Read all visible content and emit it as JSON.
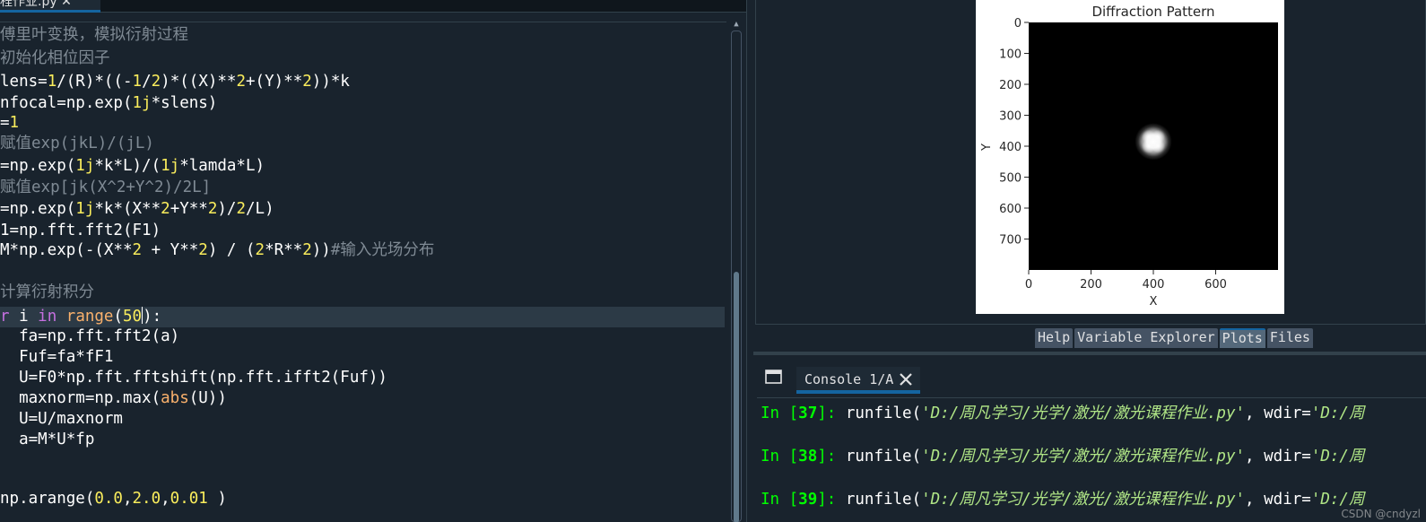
{
  "editor": {
    "tab_label": "程作业.py ✕",
    "lines": [
      [
        {
          "t": "傅里叶变换，模拟衍射过程",
          "c": "cm"
        }
      ],
      [
        {
          "t": "初始化相位因子",
          "c": "cm"
        }
      ],
      [
        {
          "t": "lens=",
          "c": ""
        },
        {
          "t": "1",
          "c": "num"
        },
        {
          "t": "/(R)*((-",
          "c": ""
        },
        {
          "t": "1",
          "c": "num"
        },
        {
          "t": "/",
          "c": ""
        },
        {
          "t": "2",
          "c": "num"
        },
        {
          "t": ")*((X)**",
          "c": ""
        },
        {
          "t": "2",
          "c": "num"
        },
        {
          "t": "+(Y)**",
          "c": ""
        },
        {
          "t": "2",
          "c": "num"
        },
        {
          "t": "))*k",
          "c": ""
        }
      ],
      [
        {
          "t": "nfocal=np.exp(",
          "c": ""
        },
        {
          "t": "1j",
          "c": "num"
        },
        {
          "t": "*slens)",
          "c": ""
        }
      ],
      [
        {
          "t": "=",
          "c": ""
        },
        {
          "t": "1",
          "c": "num"
        }
      ],
      [
        {
          "t": "赋值exp(jkL)/(jL)",
          "c": "cm"
        }
      ],
      [
        {
          "t": "=np.exp(",
          "c": ""
        },
        {
          "t": "1j",
          "c": "num"
        },
        {
          "t": "*k*L)/(",
          "c": ""
        },
        {
          "t": "1j",
          "c": "num"
        },
        {
          "t": "*lamda*L)",
          "c": ""
        }
      ],
      [
        {
          "t": "赋值exp[jk(X^2+Y^2)/2L]",
          "c": "cm"
        }
      ],
      [
        {
          "t": "=np.exp(",
          "c": ""
        },
        {
          "t": "1j",
          "c": "num"
        },
        {
          "t": "*k*(X**",
          "c": ""
        },
        {
          "t": "2",
          "c": "num"
        },
        {
          "t": "+Y**",
          "c": ""
        },
        {
          "t": "2",
          "c": "num"
        },
        {
          "t": ")/",
          "c": ""
        },
        {
          "t": "2",
          "c": "num"
        },
        {
          "t": "/L)",
          "c": ""
        }
      ],
      [
        {
          "t": "1=np.fft.fft2(F1)",
          "c": ""
        }
      ],
      [
        {
          "t": "M*np.exp(-(X**",
          "c": ""
        },
        {
          "t": "2",
          "c": "num"
        },
        {
          "t": " + Y**",
          "c": ""
        },
        {
          "t": "2",
          "c": "num"
        },
        {
          "t": ") / (",
          "c": ""
        },
        {
          "t": "2",
          "c": "num"
        },
        {
          "t": "*R**",
          "c": ""
        },
        {
          "t": "2",
          "c": "num"
        },
        {
          "t": "))",
          "c": ""
        },
        {
          "t": "#输入光场分布",
          "c": "cm"
        }
      ],
      [],
      [
        {
          "t": "计算衍射积分",
          "c": "cm"
        }
      ],
      [
        {
          "t": "r",
          "c": "kw"
        },
        {
          "t": " i ",
          "c": ""
        },
        {
          "t": "in",
          "c": "kw"
        },
        {
          "t": " ",
          "c": ""
        },
        {
          "t": "range",
          "c": "bi"
        },
        {
          "t": "(",
          "c": ""
        },
        {
          "t": "50",
          "c": "num"
        },
        {
          "t": "|",
          "c": "cursor"
        },
        {
          "t": "):",
          "c": ""
        }
      ],
      [
        {
          "t": "  fa=np.fft.fft2(a)",
          "c": ""
        }
      ],
      [
        {
          "t": "  Fuf=fa*fF1",
          "c": ""
        }
      ],
      [
        {
          "t": "  U=F0*np.fft.fftshift(np.fft.ifft2(Fuf))",
          "c": ""
        }
      ],
      [
        {
          "t": "  maxnorm=np.max(",
          "c": ""
        },
        {
          "t": "abs",
          "c": "bi"
        },
        {
          "t": "(U))",
          "c": ""
        }
      ],
      [
        {
          "t": "  U=U/maxnorm",
          "c": ""
        }
      ],
      [
        {
          "t": "  a=M*U*fp",
          "c": ""
        }
      ],
      [],
      [],
      [
        {
          "t": "np.arange(",
          "c": ""
        },
        {
          "t": "0.0",
          "c": "num"
        },
        {
          "t": ",",
          "c": ""
        },
        {
          "t": "2.0",
          "c": "num"
        },
        {
          "t": ",",
          "c": ""
        },
        {
          "t": "0.01",
          "c": "num"
        },
        {
          "t": " )",
          "c": ""
        }
      ]
    ],
    "current_line": 13,
    "line_tops": [
      38,
      64,
      90,
      114,
      136,
      159,
      184,
      208,
      232,
      256,
      278,
      302,
      325,
      352,
      374,
      397,
      420,
      443,
      466,
      489,
      512,
      535,
      555
    ]
  },
  "plot": {
    "title": "Diffraction Pattern",
    "xlabel": "X",
    "ylabel": "Y",
    "background": "#000000"
  },
  "chart_data": {
    "type": "heatmap",
    "title": "Diffraction Pattern",
    "xlabel": "X",
    "ylabel": "Y",
    "xlim": [
      0,
      800
    ],
    "ylim": [
      800,
      0
    ],
    "xticks": [
      0,
      200,
      400,
      600
    ],
    "yticks": [
      0,
      100,
      200,
      300,
      400,
      500,
      600,
      700
    ],
    "colormap": "gray",
    "spot": {
      "center_x": 400,
      "center_y": 385,
      "radius": 70
    }
  },
  "pane_tabs": [
    "Help",
    "Variable Explorer",
    "Plots",
    "Files"
  ],
  "active_pane_tab": "Plots",
  "console": {
    "tab_label": "Console 1/A",
    "lines": [
      {
        "n": "37",
        "cmd": "runfile(",
        "path": "'D:/周凡学习/光学/激光/激光课程作业.py'",
        "rest": ", wdir=",
        "wdir": "'D:/周"
      },
      {
        "n": "38",
        "cmd": "runfile(",
        "path": "'D:/周凡学习/光学/激光/激光课程作业.py'",
        "rest": ", wdir=",
        "wdir": "'D:/周"
      },
      {
        "n": "39",
        "cmd": "runfile(",
        "path": "'D:/周凡学习/光学/激光/激光课程作业.py'",
        "rest": ", wdir=",
        "wdir": "'D:/周"
      }
    ]
  },
  "watermark": "CSDN @cndyzl",
  "colors": {
    "accent": "#1464a0",
    "background": "#19232d",
    "prompt": "#00ff00",
    "string": "#b0e686",
    "number": "#faed5c",
    "keyword": "#c670e0"
  }
}
